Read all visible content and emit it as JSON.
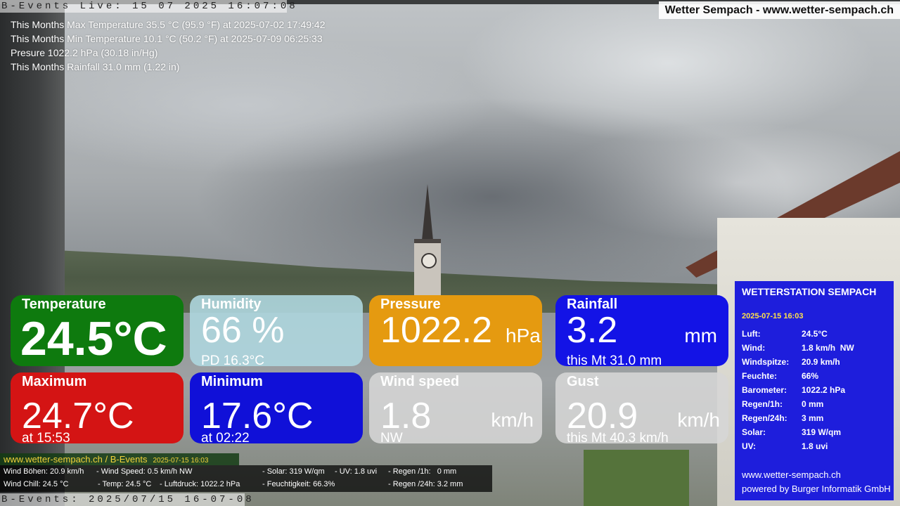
{
  "header": {
    "ticker_top": "B-Events Live: 15 07 2025 16:07:08",
    "site_title": "Wetter Sempach - www.wetter-sempach.ch"
  },
  "stats": [
    "This Months Max Temperature 35.5 °C (95.9 °F) at 2025-07-02 17:49:42",
    "This Months Min Temperature 10.1 °C (50.2 °F) at 2025-07-09 06:25:33",
    "Presure 1022.2 hPa (30.18 in/Hg)",
    "This Months Rainfall 31.0 mm (1.22 in)"
  ],
  "tiles": {
    "temperature": {
      "label": "Temperature",
      "value": "24.5°C"
    },
    "humidity": {
      "label": "Humidity",
      "value": "66 %",
      "sub": "PD 16.3°C"
    },
    "pressure": {
      "label": "Pressure",
      "value": "1022.2",
      "unit": "hPa"
    },
    "rainfall": {
      "label": "Rainfall",
      "value": "3.2",
      "unit": "mm",
      "sub": "this Mt 31.0 mm"
    },
    "maximum": {
      "label": "Maximum",
      "value": "24.7°C",
      "sub": "at 15:53"
    },
    "minimum": {
      "label": "Minimum",
      "value": "17.6°C",
      "sub": "at 02:22"
    },
    "wind": {
      "label": "Wind speed",
      "value": "1.8",
      "unit": "km/h",
      "sub": "NW"
    },
    "gust": {
      "label": "Gust",
      "value": "20.9",
      "unit": "km/h",
      "sub": "this Mt 40.3 km/h"
    }
  },
  "panel": {
    "title": "WETTERSTATION SEMPACH",
    "date": "2025-07-15 16:03",
    "rows": [
      {
        "k": "Luft:",
        "v": "24.5°C"
      },
      {
        "k": "Wind:",
        "v": "1.8 km/h  NW"
      },
      {
        "k": "Windspitze:",
        "v": "20.9 km/h"
      },
      {
        "k": "Feuchte:",
        "v": "66%"
      },
      {
        "k": "Barometer:",
        "v": "1022.2 hPa"
      },
      {
        "k": "Regen/1h:",
        "v": "0 mm"
      },
      {
        "k": "Regen/24h:",
        "v": "3 mm"
      },
      {
        "k": "Solar:",
        "v": "319 W/qm"
      },
      {
        "k": "UV:",
        "v": "1.8 uvi"
      }
    ],
    "url": "www.wetter-sempach.ch",
    "powered": "powered by Burger Informatik GmbH"
  },
  "footer": {
    "site": "www.wetter-sempach.ch / B-Events",
    "datetime": "2025-07-15 16:03",
    "line1": {
      "a": "Wind Böhen: 20.9 km/h",
      "b": "- Wind Speed: 0.5 km/h NW",
      "c": "- Solar: 319 W/qm",
      "d": "- UV: 1.8 uvi",
      "e": "- Regen /1h:   0 mm"
    },
    "line2": {
      "a": "Wind Chill: 24.5 °C",
      "b": "- Temp: 24.5 °C",
      "c": "- Luftdruck: 1022.2 hPa",
      "d": "- Feuchtigkeit: 66.3%",
      "e": "- Regen /24h: 3.2 mm"
    },
    "ticker_bottom": "B-Events: 2025/07/15 16-07-08"
  }
}
